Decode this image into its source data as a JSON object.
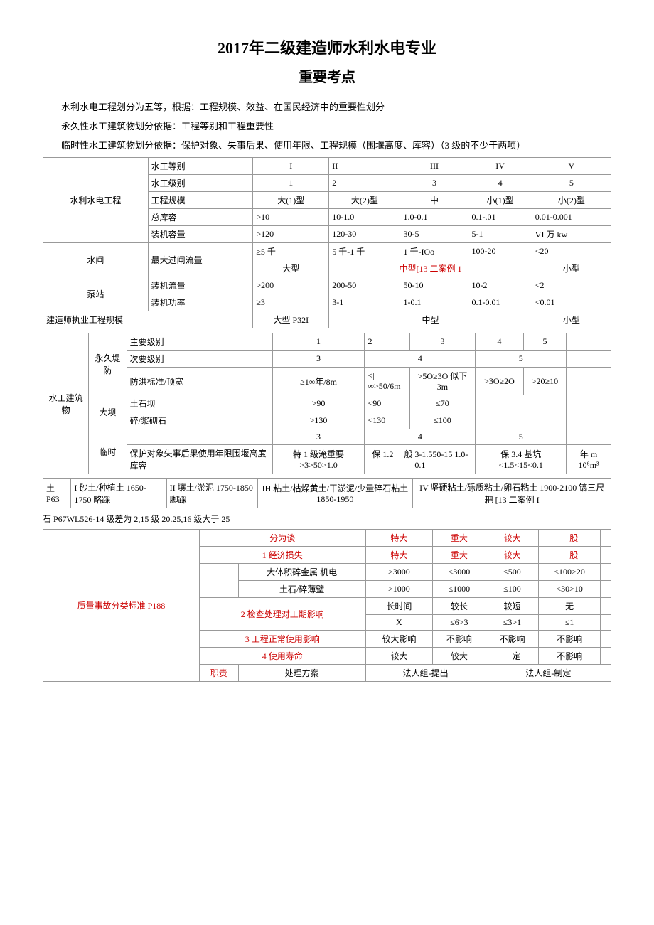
{
  "title1": "2017年二级建造师水利水电专业",
  "title2": "重要考点",
  "p1": "水利水电工程划分为五等，根据：工程规模、效益、在国民经济中的重要性划分",
  "p2": "永久性水工建筑物划分依据：工程等别和工程重要性",
  "p3": "临时性水工建筑物划分依据：保护对象、失事后果、使用年限、工程规模（围堰高度、库容）（3 级的不少于两项）",
  "t1": {
    "r0": [
      "水利水电工程",
      "水工等别",
      "I",
      "II",
      "III",
      "IV",
      "V"
    ],
    "r1": [
      "水工级别",
      "1",
      "2",
      "3",
      "4",
      "5"
    ],
    "r2": [
      "工程规模",
      "大(1)型",
      "大(2)型",
      "中",
      "小(1)型",
      "小(2)型"
    ],
    "r3": [
      "总库容",
      ">10",
      "10-1.0",
      "1.0-0.1",
      "0.1-.01",
      "0.01-0.001"
    ],
    "r4": [
      "装机容量",
      ">120",
      "120-30",
      "30-5",
      "5-1",
      "VI 万 kw"
    ],
    "r5": [
      "水闸",
      "最大过闸流量",
      "≥5 千",
      "5 千-1 千",
      "1 千-IOo",
      "100-20",
      "<20"
    ],
    "r6": [
      "大型",
      "中型[13 二案例 1",
      "小型"
    ],
    "r7": [
      "泵站",
      "装机流量",
      ">200",
      "200-50",
      "50-10",
      "10-2",
      "<2"
    ],
    "r8": [
      "装机功率",
      "≥3",
      "3-1",
      "1-0.1",
      "0.1-0.01",
      "<0.01"
    ],
    "r9": [
      "建造师执业工程规模",
      "大型 P32I",
      "中型",
      "小型"
    ]
  },
  "t2": {
    "side": "水工建筑物",
    "r0": [
      "永久堤防",
      "主要级别",
      "1",
      "2",
      "3",
      "4",
      "5"
    ],
    "r1": [
      "次要级别",
      "3",
      "4",
      "5"
    ],
    "r2": [
      "防洪标准/顶宽",
      "≥1∞年/8m",
      "<|∞>50/6m",
      ">5O≥3O 似下 3m",
      ">3O≥2O",
      ">20≥10"
    ],
    "r3": [
      "大坝",
      "土石坝",
      ">90",
      "<90",
      "≤70"
    ],
    "r4": [
      "碎/浆砌石",
      ">130",
      "<130",
      "≤100"
    ],
    "r5": [
      "",
      "3",
      "4",
      "5"
    ],
    "r6l": "临时",
    "r6a": "保护对象失事后果使用年限围堰高度库容",
    "r6b": "特 1 级淹重要 >3>50>1.0",
    "r6c": "保 1.2 一般 3-1.550-15 1.0-0.1",
    "r6d": "保 3.4 基坑 <1.5<15<0.1",
    "r6e": "年 m 10⁶m³"
  },
  "t3": {
    "r0": [
      "土 P63",
      "I 砂土/种植土 1650-1750 略踩",
      "II 壤土/淤泥 1750-1850 脚踩",
      "IH 粘土/枯燥黄土/干淤泥/少量碎石粘土 1850-1950",
      "IV 坚硬粘土/砾质粘土/卵石粘土 1900-2100 镐三尺耙 [13 二案例 I"
    ]
  },
  "note1": "石 P67WL526-14 级差为 2,15 级 20.25,16 级大于 25",
  "t4": {
    "side": "质量事故分类标准 P188",
    "h": [
      "分为谈",
      "特大",
      "重大",
      "较大",
      "一股"
    ],
    "r1": [
      "1 经济损失",
      "特大",
      "重大",
      "较大",
      "一股"
    ],
    "r2a": "大体积碎金属 机电",
    "r2": [
      ">3000",
      "<3000",
      "≤500",
      "≤100>20"
    ],
    "r3a": "土石/碎薄壁",
    "r3": [
      ">1000",
      "≤1000",
      "≤100",
      "<30>10"
    ],
    "r4a": "2 检查处理对工期影响",
    "r4": [
      "长时间",
      "较长",
      "较短",
      "无"
    ],
    "r5": [
      "X",
      "≤6>3",
      "≤3>1",
      "≤1"
    ],
    "r6": [
      "3 工程正常使用影响",
      "较大影响",
      "不影响",
      "不影响",
      "不影响"
    ],
    "r7": [
      "4 使用寿命",
      "较大",
      "较大",
      "一定",
      "不影响"
    ],
    "r8a": "职责",
    "r8b": "处理方案",
    "r8c": "法人组-提出",
    "r8d": "法人组-制定"
  }
}
